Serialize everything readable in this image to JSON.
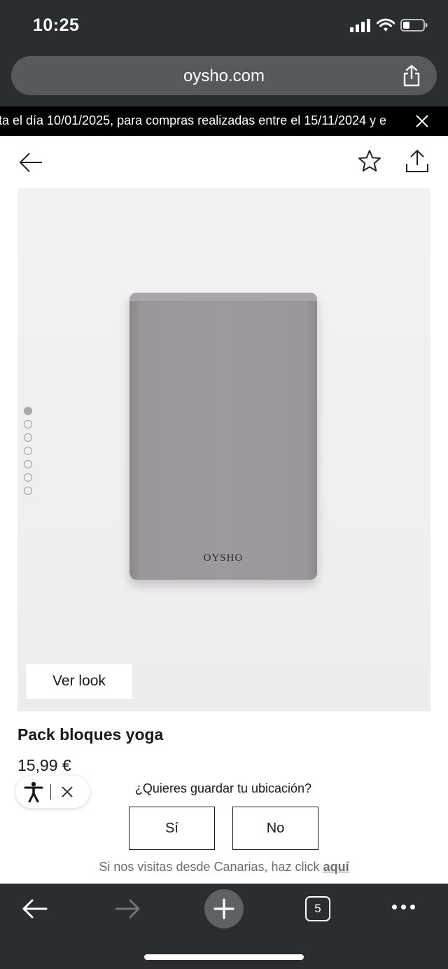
{
  "status_bar": {
    "time": "10:25",
    "icons": [
      "signal-icon",
      "wifi-icon",
      "battery-icon"
    ]
  },
  "browser": {
    "url": "oysho.com",
    "tab_count": "5"
  },
  "promo": {
    "text": "ta el día 10/01/2025, para compras realizadas entre el 15/11/2024 y e"
  },
  "product": {
    "logo_text": "OYSHO",
    "ver_look": "Ver look",
    "title": "Pack bloques yoga",
    "price": "15,99 €",
    "gallery": {
      "image_count": 7,
      "active_index": 0
    }
  },
  "location_prompt": {
    "question": "¿Quieres guardar tu ubicación?",
    "yes_label": "Sí",
    "no_label": "No",
    "canarias_text": "Si nos visitas desde Canarias, haz click ",
    "canarias_link": "aquí"
  },
  "colors": {
    "chrome_bg": "#2b2e31",
    "promo_bg": "#000000",
    "block_gray": "#9d999e"
  }
}
